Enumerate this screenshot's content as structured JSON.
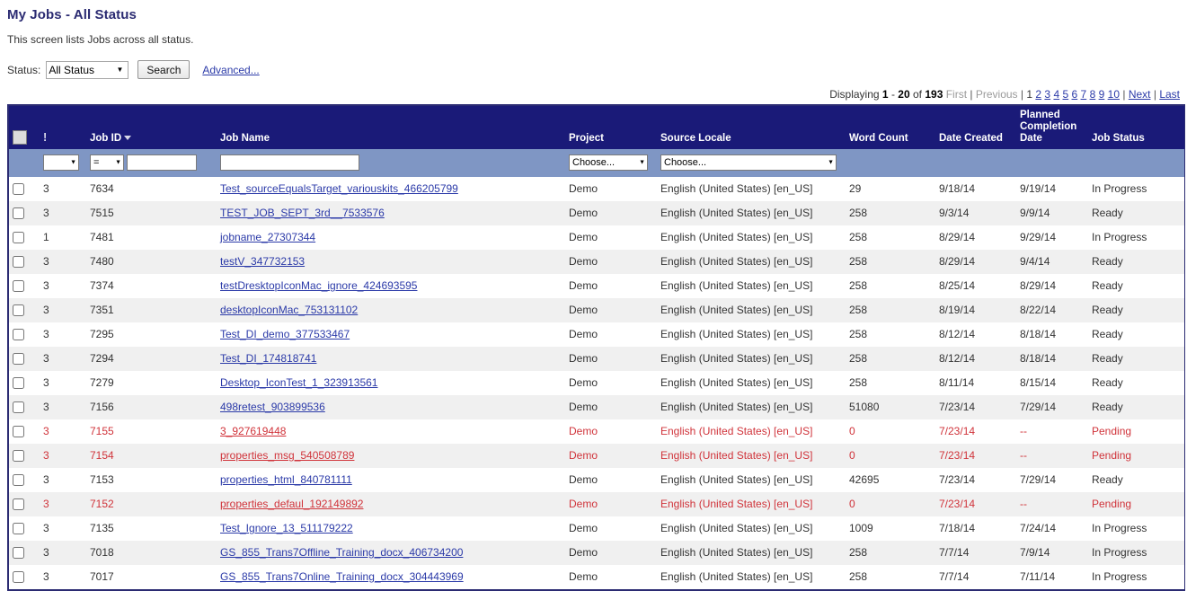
{
  "header": {
    "title": "My Jobs - All Status",
    "description": "This screen lists Jobs across all status."
  },
  "search": {
    "status_label": "Status:",
    "status_value": "All Status",
    "status_options": [
      "All Status"
    ],
    "search_button": "Search",
    "advanced_link": "Advanced..."
  },
  "paging": {
    "displaying_label": "Displaying",
    "range_start": "1",
    "dash": "-",
    "range_end": "20",
    "of_label": "of",
    "total": "193",
    "first": "First",
    "previous": "Previous",
    "pages": [
      "1",
      "2",
      "3",
      "4",
      "5",
      "6",
      "7",
      "8",
      "9",
      "10"
    ],
    "next": "Next",
    "last": "Last"
  },
  "table": {
    "columns": {
      "checkbox": "",
      "priority": "!",
      "job_id": "Job ID",
      "job_name": "Job Name",
      "project": "Project",
      "source_locale": "Source Locale",
      "word_count": "Word Count",
      "date_created": "Date Created",
      "planned_completion_date": "Planned Completion Date",
      "job_status": "Job Status"
    },
    "filters": {
      "priority_value": "",
      "operator_value": "=",
      "job_id_value": "",
      "job_name_value": "",
      "project_value": "Choose...",
      "source_locale_value": "Choose..."
    },
    "rows": [
      {
        "priority": "3",
        "job_id": "7634",
        "job_name": "Test_sourceEqualsTarget_variouskits_466205799",
        "project": "Demo",
        "source_locale": "English (United States) [en_US]",
        "word_count": "29",
        "date_created": "9/18/14",
        "planned_completion_date": "9/19/14",
        "job_status": "In Progress",
        "alert": false
      },
      {
        "priority": "3",
        "job_id": "7515",
        "job_name": "TEST_JOB_SEPT_3rd__7533576",
        "project": "Demo",
        "source_locale": "English (United States) [en_US]",
        "word_count": "258",
        "date_created": "9/3/14",
        "planned_completion_date": "9/9/14",
        "job_status": "Ready",
        "alert": false
      },
      {
        "priority": "1",
        "job_id": "7481",
        "job_name": "jobname_27307344",
        "project": "Demo",
        "source_locale": "English (United States) [en_US]",
        "word_count": "258",
        "date_created": "8/29/14",
        "planned_completion_date": "9/29/14",
        "job_status": "In Progress",
        "alert": false
      },
      {
        "priority": "3",
        "job_id": "7480",
        "job_name": "testV_347732153",
        "project": "Demo",
        "source_locale": "English (United States) [en_US]",
        "word_count": "258",
        "date_created": "8/29/14",
        "planned_completion_date": "9/4/14",
        "job_status": "Ready",
        "alert": false
      },
      {
        "priority": "3",
        "job_id": "7374",
        "job_name": "testDresktopIconMac_ignore_424693595",
        "project": "Demo",
        "source_locale": "English (United States) [en_US]",
        "word_count": "258",
        "date_created": "8/25/14",
        "planned_completion_date": "8/29/14",
        "job_status": "Ready",
        "alert": false
      },
      {
        "priority": "3",
        "job_id": "7351",
        "job_name": "desktopIconMac_753131102",
        "project": "Demo",
        "source_locale": "English (United States) [en_US]",
        "word_count": "258",
        "date_created": "8/19/14",
        "planned_completion_date": "8/22/14",
        "job_status": "Ready",
        "alert": false
      },
      {
        "priority": "3",
        "job_id": "7295",
        "job_name": "Test_DI_demo_377533467",
        "project": "Demo",
        "source_locale": "English (United States) [en_US]",
        "word_count": "258",
        "date_created": "8/12/14",
        "planned_completion_date": "8/18/14",
        "job_status": "Ready",
        "alert": false
      },
      {
        "priority": "3",
        "job_id": "7294",
        "job_name": "Test_DI_174818741",
        "project": "Demo",
        "source_locale": "English (United States) [en_US]",
        "word_count": "258",
        "date_created": "8/12/14",
        "planned_completion_date": "8/18/14",
        "job_status": "Ready",
        "alert": false
      },
      {
        "priority": "3",
        "job_id": "7279",
        "job_name": "Desktop_IconTest_1_323913561",
        "project": "Demo",
        "source_locale": "English (United States) [en_US]",
        "word_count": "258",
        "date_created": "8/11/14",
        "planned_completion_date": "8/15/14",
        "job_status": "Ready",
        "alert": false
      },
      {
        "priority": "3",
        "job_id": "7156",
        "job_name": "498retest_903899536",
        "project": "Demo",
        "source_locale": "English (United States) [en_US]",
        "word_count": "51080",
        "date_created": "7/23/14",
        "planned_completion_date": "7/29/14",
        "job_status": "Ready",
        "alert": false
      },
      {
        "priority": "3",
        "job_id": "7155",
        "job_name": "3_927619448",
        "project": "Demo",
        "source_locale": "English (United States) [en_US]",
        "word_count": "0",
        "date_created": "7/23/14",
        "planned_completion_date": "--",
        "job_status": "Pending",
        "alert": true
      },
      {
        "priority": "3",
        "job_id": "7154",
        "job_name": "properties_msg_540508789",
        "project": "Demo",
        "source_locale": "English (United States) [en_US]",
        "word_count": "0",
        "date_created": "7/23/14",
        "planned_completion_date": "--",
        "job_status": "Pending",
        "alert": true
      },
      {
        "priority": "3",
        "job_id": "7153",
        "job_name": "properties_html_840781111",
        "project": "Demo",
        "source_locale": "English (United States) [en_US]",
        "word_count": "42695",
        "date_created": "7/23/14",
        "planned_completion_date": "7/29/14",
        "job_status": "Ready",
        "alert": false
      },
      {
        "priority": "3",
        "job_id": "7152",
        "job_name": "properties_defaul_192149892",
        "project": "Demo",
        "source_locale": "English (United States) [en_US]",
        "word_count": "0",
        "date_created": "7/23/14",
        "planned_completion_date": "--",
        "job_status": "Pending",
        "alert": true
      },
      {
        "priority": "3",
        "job_id": "7135",
        "job_name": "Test_Ignore_13_511179222",
        "project": "Demo",
        "source_locale": "English (United States) [en_US]",
        "word_count": "1009",
        "date_created": "7/18/14",
        "planned_completion_date": "7/24/14",
        "job_status": "In Progress",
        "alert": false
      },
      {
        "priority": "3",
        "job_id": "7018",
        "job_name": "GS_855_Trans7Offline_Training_docx_406734200",
        "project": "Demo",
        "source_locale": "English (United States) [en_US]",
        "word_count": "258",
        "date_created": "7/7/14",
        "planned_completion_date": "7/9/14",
        "job_status": "In Progress",
        "alert": false
      },
      {
        "priority": "3",
        "job_id": "7017",
        "job_name": "GS_855_Trans7Online_Training_docx_304443969",
        "project": "Demo",
        "source_locale": "English (United States) [en_US]",
        "word_count": "258",
        "date_created": "7/7/14",
        "planned_completion_date": "7/11/14",
        "job_status": "In Progress",
        "alert": false
      }
    ]
  },
  "colors": {
    "header_bg": "#1a1a78",
    "filter_bg": "#7f96c4",
    "title": "#2b2b72",
    "link": "#2b3aa8",
    "alert": "#d0333a",
    "row_alt": "#f0f0f0"
  }
}
